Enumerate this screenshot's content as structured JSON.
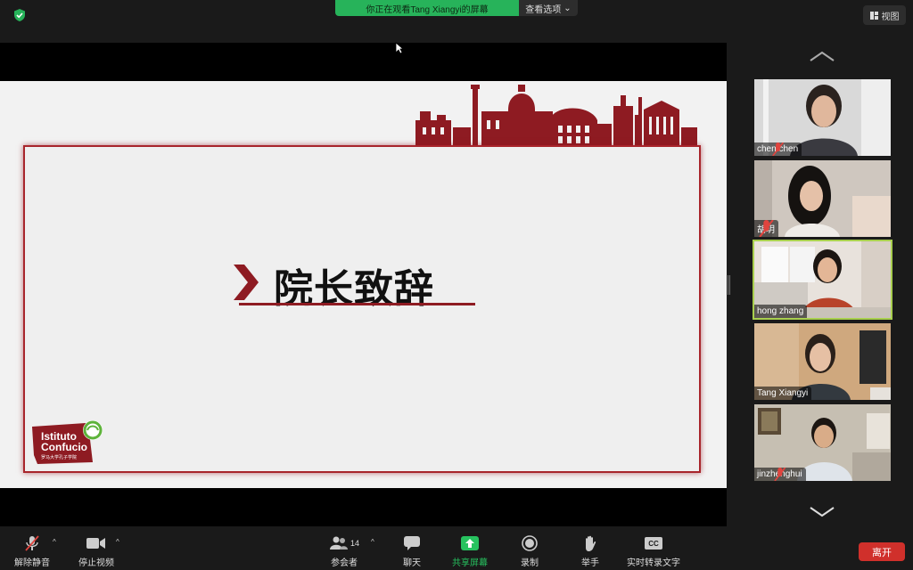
{
  "topbar": {
    "banner_text": "你正在观看Tang Xiangyi的屏幕",
    "view_options_label": "查看选项",
    "view_button_label": "视图"
  },
  "slide": {
    "title": "院长致辞",
    "logo_line1": "Istituto",
    "logo_line2": "Confucio",
    "logo_line3": "罗马大学孔子学院"
  },
  "participants": [
    {
      "name": "chen chen",
      "muted": true
    },
    {
      "name": "胡玥",
      "muted": true
    },
    {
      "name": "hong zhang",
      "muted": false,
      "active": true
    },
    {
      "name": "Tang Xiangyi",
      "muted": false
    },
    {
      "name": "jinzhenghui",
      "muted": true
    }
  ],
  "toolbar": {
    "unmute": "解除静音",
    "stop_video": "停止视频",
    "participants": "参会者",
    "participants_count": "14",
    "chat": "聊天",
    "share_screen": "共享屏幕",
    "record": "录制",
    "raise_hand": "举手",
    "live_transcript": "实时转录文字",
    "cc": "CC",
    "leave": "离开"
  },
  "colors": {
    "accent_green": "#27b35a",
    "slide_red": "#a8252b",
    "leave_red": "#d0302b",
    "active_speaker": "#a8cf4e"
  }
}
